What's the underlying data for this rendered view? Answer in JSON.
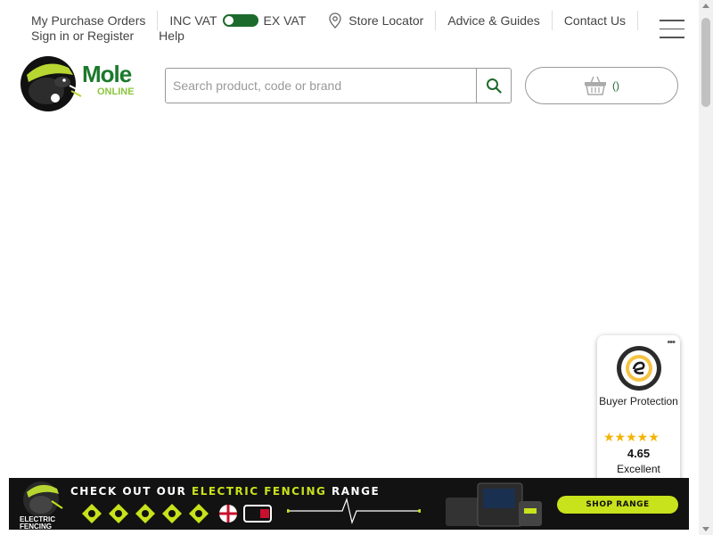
{
  "topbar": {
    "purchase_orders": "My Purchase Orders",
    "inc_vat": "INC VAT",
    "ex_vat": "EX VAT",
    "store_locator": "Store Locator",
    "advice": "Advice & Guides",
    "contact": "Contact Us",
    "sign_in": "Sign in or Register",
    "help": "Help"
  },
  "logo": {
    "word": "Mole",
    "sub": "ONLINE"
  },
  "search": {
    "placeholder": "Search product, code or brand",
    "value": ""
  },
  "basket": {
    "count": "()"
  },
  "trust": {
    "buyer_protection": "Buyer Protection",
    "stars": "★★★★★",
    "rating": "4.65",
    "verdict": "Excellent",
    "menu": "•••"
  },
  "banner": {
    "headline_a": "CHECK OUT OUR ",
    "headline_b": "ELECTRIC FENCING",
    "headline_c": " RANGE",
    "label": "ELECTRIC FENCING",
    "cta": "SHOP RANGE"
  },
  "colors": {
    "brand_green": "#1b7a2b",
    "lime": "#c8e21b",
    "star": "#f5b301"
  }
}
